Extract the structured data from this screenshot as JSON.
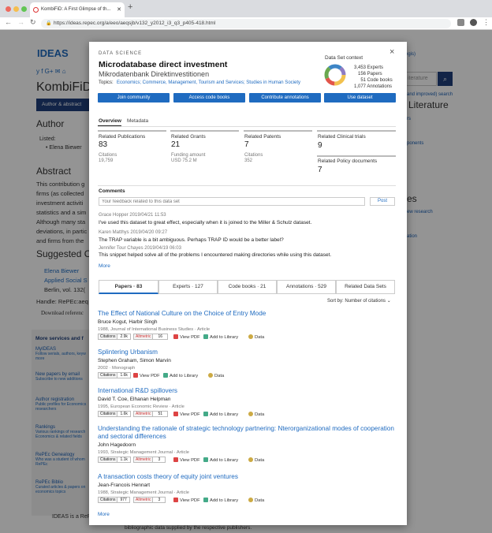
{
  "browser": {
    "tab_title": "KombiFiD: A First Glimpse of th...",
    "new_tab": "+",
    "url": "https://ideas.repec.org/a/eeo/aeqsjb/v132_y2012_i3_q3_p405-418.html"
  },
  "background": {
    "logo": "IDEAS",
    "title": "KombiFiD:",
    "author_btn": "Author & abstract",
    "search_placeholder": "iterature",
    "improved": "(and improved) search",
    "literature": "Literature",
    "author_heading": "Author",
    "listed": "Listed:",
    "author_name": "• Elena Biewer",
    "abstract_heading": "Abstract",
    "abstract_lines": [
      "This contribution g",
      "firms (as collected",
      "investment activiti",
      "statistics and a sim",
      "Although many sta",
      "deviations, in partic",
      "and firms from the"
    ],
    "suggested_heading": "Suggested Cit",
    "suggested_lines": [
      "Elena Biewer",
      "Applied Social S",
      "Berlin, vol. 132("
    ],
    "handle": "Handle: RePEc:aeq",
    "download": "Download referenc",
    "services_heading": "More services and f",
    "services": [
      {
        "title": "MyIDEAS",
        "desc": "Follow serials, authors, keyw more"
      },
      {
        "title": "New papers by email",
        "desc": "Subscribe to new additions"
      },
      {
        "title": "Author registration",
        "desc": "Public profiles for Economics researchers"
      },
      {
        "title": "Rankings",
        "desc": "Various rankings of research Economics & related fields"
      },
      {
        "title": "RePEc Genealogy",
        "desc": "Who was a student of whom RePEc"
      },
      {
        "title": "RePEc Biblio",
        "desc": "Curated articles & papers on economics topics"
      }
    ],
    "right_links": [
      "rs",
      "ponents",
      "es",
      "ew research",
      "ation"
    ],
    "top_right": "egis)",
    "footer": "IDEAS is a RePE",
    "footer2": "bibliographic data supplied by the respective publishers."
  },
  "modal": {
    "kicker": "DATA SCIENCE",
    "title": "Microdatabase direct investment",
    "subtitle": "Mikrodatenbank Direktinvestitionen",
    "topics_label": "Topics:",
    "topics": "Economics; Commerce, Management, Tourism and Services; Studies in Human Society",
    "context_label": "Data Set context",
    "context": [
      {
        "num": "3,453",
        "label": "Experts"
      },
      {
        "num": "156",
        "label": "Papers"
      },
      {
        "num": "51",
        "label": "Code books"
      },
      {
        "num": "1,077",
        "label": "Annotations"
      }
    ],
    "buttons": [
      "Join community",
      "Access code books",
      "Contribute annotations",
      "Use dataset"
    ],
    "close": "×",
    "tabs": [
      "Overview",
      "Metadata"
    ],
    "stats": {
      "pub_label": "Related Publications",
      "pub_num": "83",
      "pub_sub1": "Citations",
      "pub_sub2": "19,759",
      "grant_label": "Related Grants",
      "grant_num": "21",
      "grant_sub1": "Funding amount",
      "grant_sub2": "USD 75.2 M",
      "patent_label": "Related Patents",
      "patent_num": "7",
      "patent_sub1": "Citations",
      "patent_sub2": "352",
      "trial_label": "Related Clinical trials",
      "trial_num": "9",
      "policy_label": "Related Policy documents",
      "policy_num": "7"
    },
    "comments_label": "Comments",
    "comment_placeholder": "Your feedback related to this data set",
    "post": "Post",
    "comments": [
      {
        "meta": "Grace Hopper   2019/04/21  11:53",
        "text": "I've used this dataset to great effect, especially when it is joined to the Miller & Schulz dataset."
      },
      {
        "meta": "Karen Matthys   2019/04/20  09:27",
        "text": "The TRAP variable is a bit ambiguous. Perhaps TRAP ID would be a better label?"
      },
      {
        "meta": "Jennifer Tour Chayes   2019/04/19  06:03",
        "text": "This snippet helped solve all of the problems I encountered making directories while using this dataset."
      }
    ],
    "more": "More",
    "lower_tabs": [
      "Papers · 83",
      "Experts · 127",
      "Code books · 21",
      "Annotations · 529",
      "Related Data Sets"
    ],
    "sort": "Sort by: Number of citations ⌄",
    "papers": [
      {
        "title": "The Effect of National Culture on the Choice of Entry Mode",
        "authors": "Bruce Kogut, Harbir Singh",
        "meta": "1988, Journal of International Business Studies · Article",
        "citations": "2.9k",
        "altmetric": "16"
      },
      {
        "title": "Splintering Urbanism",
        "authors": "Stephen Graham, Simon Marvin",
        "meta": "2002 · Monograph",
        "citations": "1.6k",
        "altmetric": ""
      },
      {
        "title": "International R&D spillovers",
        "authors": "David T. Coe, Elhanan Helpman",
        "meta": "1995, European Economic Review · Article",
        "citations": "1.6k",
        "altmetric": "51"
      },
      {
        "title": "Understanding the rationale of strategic technology partnering: Nterorganizational modes of cooperation",
        "title2": "and sectoral differences",
        "authors": "John Hagedoorn",
        "meta": "1993, Strategic Management Journal · Article",
        "citations": "1.1k",
        "altmetric": "3"
      },
      {
        "title": "A transaction costs theory of equity joint ventures",
        "authors": "Jean-Francois Hennart",
        "meta": "1988, Strategic Management Journal · Article",
        "citations": "977",
        "altmetric": "3"
      }
    ],
    "badge_citations": "Citations",
    "badge_altmetric": "Altmetric",
    "view_pdf": "View PDF",
    "add_library": "Add to Library",
    "data": "Data",
    "papers_more": "More"
  }
}
